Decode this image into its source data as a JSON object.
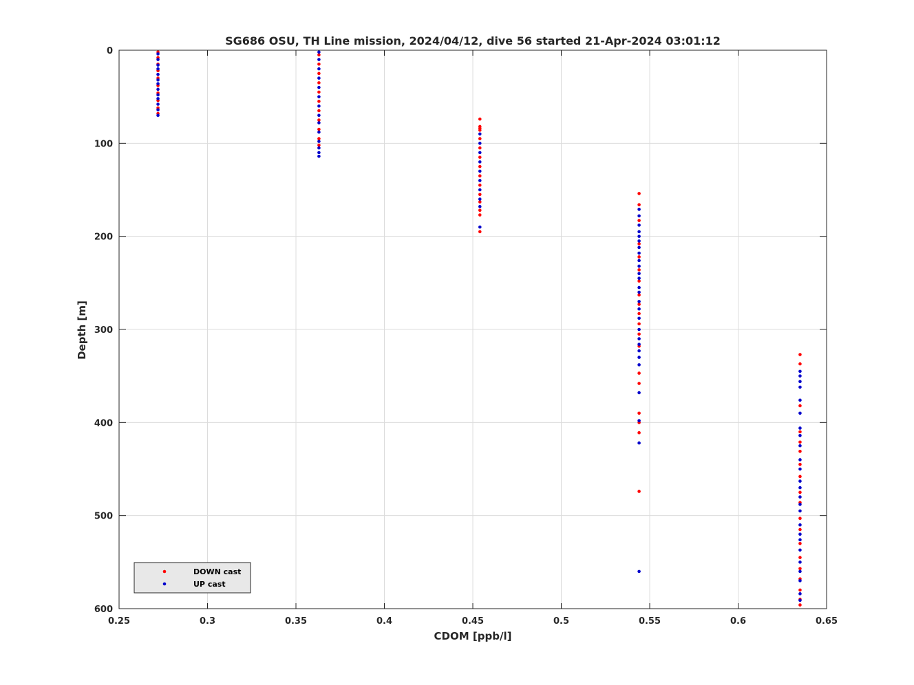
{
  "chart_data": {
    "type": "scatter",
    "title": "SG686 OSU, TH Line mission, 2024/04/12, dive 56 started 21-Apr-2024 03:01:12",
    "xlabel": "CDOM [ppb/l]",
    "ylabel": "Depth [m]",
    "xlim": [
      0.25,
      0.65
    ],
    "ylim": [
      0,
      600
    ],
    "y_reversed": true,
    "grid": true,
    "x_ticks": [
      "0.25",
      "0.3",
      "0.35",
      "0.4",
      "0.45",
      "0.5",
      "0.55",
      "0.6",
      "0.65"
    ],
    "y_ticks": [
      "0",
      "100",
      "200",
      "300",
      "400",
      "500",
      "600"
    ],
    "legend_position": "bottom-left",
    "series": [
      {
        "name": "DOWN cast",
        "color": "#ff0000",
        "points": [
          [
            0.272,
            2
          ],
          [
            0.272,
            8
          ],
          [
            0.272,
            15
          ],
          [
            0.272,
            22
          ],
          [
            0.272,
            30
          ],
          [
            0.272,
            38
          ],
          [
            0.272,
            46
          ],
          [
            0.272,
            54
          ],
          [
            0.272,
            62
          ],
          [
            0.272,
            68
          ],
          [
            0.363,
            5
          ],
          [
            0.363,
            15
          ],
          [
            0.363,
            25
          ],
          [
            0.363,
            35
          ],
          [
            0.363,
            45
          ],
          [
            0.363,
            55
          ],
          [
            0.363,
            65
          ],
          [
            0.363,
            75
          ],
          [
            0.363,
            85
          ],
          [
            0.363,
            95
          ],
          [
            0.363,
            102
          ],
          [
            0.454,
            74
          ],
          [
            0.454,
            82
          ],
          [
            0.454,
            84
          ],
          [
            0.454,
            86
          ],
          [
            0.454,
            95
          ],
          [
            0.454,
            105
          ],
          [
            0.454,
            115
          ],
          [
            0.454,
            125
          ],
          [
            0.454,
            135
          ],
          [
            0.454,
            145
          ],
          [
            0.454,
            155
          ],
          [
            0.454,
            163
          ],
          [
            0.454,
            172
          ],
          [
            0.454,
            177
          ],
          [
            0.454,
            195
          ],
          [
            0.544,
            154
          ],
          [
            0.544,
            166
          ],
          [
            0.544,
            183
          ],
          [
            0.544,
            208
          ],
          [
            0.544,
            222
          ],
          [
            0.544,
            236
          ],
          [
            0.544,
            248
          ],
          [
            0.544,
            263
          ],
          [
            0.544,
            273
          ],
          [
            0.544,
            283
          ],
          [
            0.544,
            294
          ],
          [
            0.544,
            305
          ],
          [
            0.544,
            318
          ],
          [
            0.544,
            347
          ],
          [
            0.544,
            358
          ],
          [
            0.544,
            390
          ],
          [
            0.544,
            400
          ],
          [
            0.544,
            411
          ],
          [
            0.544,
            474
          ],
          [
            0.635,
            327
          ],
          [
            0.635,
            337
          ],
          [
            0.635,
            382
          ],
          [
            0.635,
            410
          ],
          [
            0.635,
            421
          ],
          [
            0.635,
            431
          ],
          [
            0.635,
            445
          ],
          [
            0.635,
            458
          ],
          [
            0.635,
            475
          ],
          [
            0.635,
            486
          ],
          [
            0.635,
            503
          ],
          [
            0.635,
            515
          ],
          [
            0.635,
            530
          ],
          [
            0.635,
            545
          ],
          [
            0.635,
            557
          ],
          [
            0.635,
            568
          ],
          [
            0.635,
            580
          ],
          [
            0.635,
            590
          ],
          [
            0.635,
            596
          ]
        ]
      },
      {
        "name": "UP cast",
        "color": "#0000cc",
        "points": [
          [
            0.272,
            4
          ],
          [
            0.272,
            10
          ],
          [
            0.272,
            16
          ],
          [
            0.272,
            20
          ],
          [
            0.272,
            26
          ],
          [
            0.272,
            32
          ],
          [
            0.272,
            36
          ],
          [
            0.272,
            42
          ],
          [
            0.272,
            48
          ],
          [
            0.272,
            52
          ],
          [
            0.272,
            58
          ],
          [
            0.272,
            64
          ],
          [
            0.272,
            70
          ],
          [
            0.363,
            2
          ],
          [
            0.363,
            10
          ],
          [
            0.363,
            20
          ],
          [
            0.363,
            30
          ],
          [
            0.363,
            40
          ],
          [
            0.363,
            50
          ],
          [
            0.363,
            60
          ],
          [
            0.363,
            70
          ],
          [
            0.363,
            78
          ],
          [
            0.363,
            88
          ],
          [
            0.363,
            98
          ],
          [
            0.363,
            105
          ],
          [
            0.363,
            110
          ],
          [
            0.363,
            114
          ],
          [
            0.454,
            90
          ],
          [
            0.454,
            100
          ],
          [
            0.454,
            110
          ],
          [
            0.454,
            120
          ],
          [
            0.454,
            130
          ],
          [
            0.454,
            140
          ],
          [
            0.454,
            150
          ],
          [
            0.454,
            160
          ],
          [
            0.454,
            168
          ],
          [
            0.454,
            190
          ],
          [
            0.544,
            171
          ],
          [
            0.544,
            178
          ],
          [
            0.544,
            188
          ],
          [
            0.544,
            195
          ],
          [
            0.544,
            200
          ],
          [
            0.544,
            205
          ],
          [
            0.544,
            212
          ],
          [
            0.544,
            218
          ],
          [
            0.544,
            226
          ],
          [
            0.544,
            232
          ],
          [
            0.544,
            240
          ],
          [
            0.544,
            245
          ],
          [
            0.544,
            255
          ],
          [
            0.544,
            260
          ],
          [
            0.544,
            270
          ],
          [
            0.544,
            278
          ],
          [
            0.544,
            288
          ],
          [
            0.544,
            300
          ],
          [
            0.544,
            310
          ],
          [
            0.544,
            316
          ],
          [
            0.544,
            323
          ],
          [
            0.544,
            330
          ],
          [
            0.544,
            338
          ],
          [
            0.544,
            368
          ],
          [
            0.544,
            398
          ],
          [
            0.544,
            422
          ],
          [
            0.544,
            560
          ],
          [
            0.635,
            345
          ],
          [
            0.635,
            350
          ],
          [
            0.635,
            356
          ],
          [
            0.635,
            362
          ],
          [
            0.635,
            376
          ],
          [
            0.635,
            390
          ],
          [
            0.635,
            406
          ],
          [
            0.635,
            414
          ],
          [
            0.635,
            425
          ],
          [
            0.635,
            440
          ],
          [
            0.635,
            450
          ],
          [
            0.635,
            463
          ],
          [
            0.635,
            470
          ],
          [
            0.635,
            480
          ],
          [
            0.635,
            488
          ],
          [
            0.635,
            495
          ],
          [
            0.635,
            510
          ],
          [
            0.635,
            520
          ],
          [
            0.635,
            526
          ],
          [
            0.635,
            537
          ],
          [
            0.635,
            550
          ],
          [
            0.635,
            560
          ],
          [
            0.635,
            570
          ],
          [
            0.635,
            584
          ],
          [
            0.635,
            591
          ]
        ]
      }
    ]
  }
}
